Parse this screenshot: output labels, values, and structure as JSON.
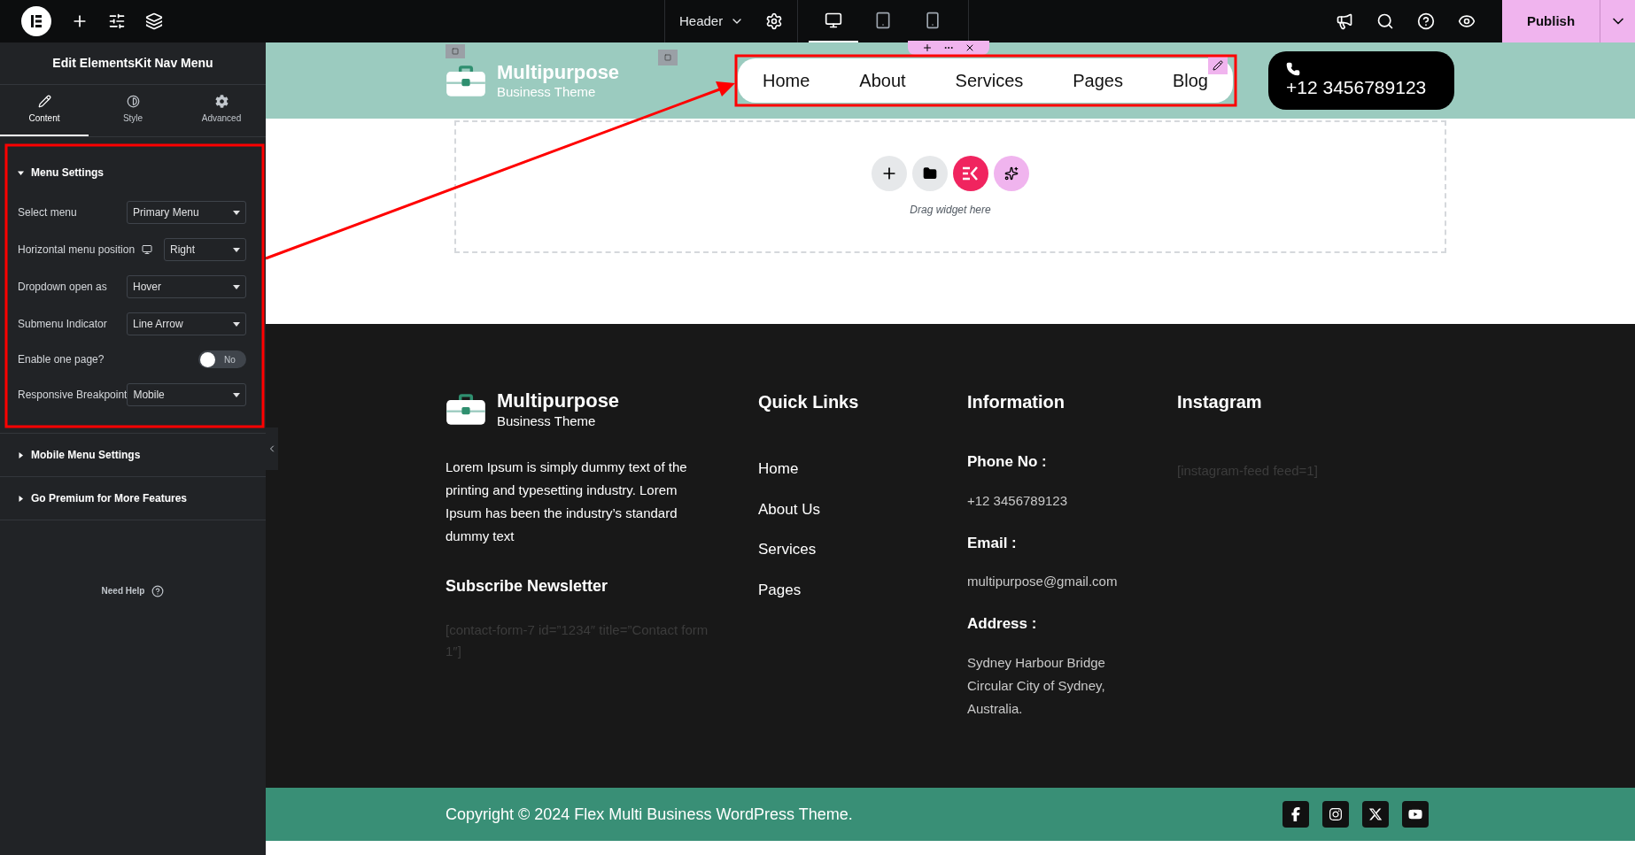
{
  "top_bar": {
    "document": "Header",
    "device_modes": [
      {
        "kind": "desktop",
        "selected": true
      },
      {
        "kind": "tablet",
        "selected": false
      },
      {
        "kind": "mobile",
        "selected": false
      }
    ],
    "publish": "Publish"
  },
  "panel": {
    "title": "Edit ElementsKit Nav Menu",
    "tabs": [
      {
        "kind": "content",
        "label": "Content",
        "selected": true
      },
      {
        "kind": "style",
        "label": "Style",
        "selected": false
      },
      {
        "kind": "advanced",
        "label": "Advanced",
        "selected": false
      }
    ],
    "sections": [
      {
        "title": "Menu Settings",
        "expanded": true,
        "fields": [
          {
            "kind": "select",
            "label": "Select menu",
            "value": "Primary Menu",
            "device_icon": false
          },
          {
            "kind": "select",
            "label": "Horizontal menu position",
            "value": "Right",
            "device_icon": true
          },
          {
            "kind": "select",
            "label": "Dropdown open as",
            "value": "Hover",
            "device_icon": false
          },
          {
            "kind": "select",
            "label": "Submenu Indicator",
            "value": "Line Arrow",
            "device_icon": false
          },
          {
            "kind": "toggle",
            "label": "Enable one page?",
            "value": "No",
            "on": false
          },
          {
            "kind": "select",
            "label": "Responsive Breakpoint",
            "value": "Mobile",
            "device_icon": false
          }
        ]
      },
      {
        "title": "Mobile Menu Settings",
        "expanded": false
      },
      {
        "title": "Go Premium for More Features",
        "expanded": false
      }
    ],
    "help": "Need Help"
  },
  "header": {
    "logo_title": "Multipurpose",
    "logo_subtitle": "Business Theme",
    "nav": [
      "Home",
      "About",
      "Services",
      "Pages",
      "Blog"
    ],
    "phone": "+12 3456789123"
  },
  "drop_zone": {
    "hint": "Drag widget here"
  },
  "footer": {
    "logo_title": "Multipurpose",
    "logo_subtitle": "Business Theme",
    "about": "Lorem Ipsum is simply dummy text of the printing and typesetting industry. Lorem Ipsum has been the industry’s standard dummy text",
    "newsletter_title": "Subscribe Newsletter",
    "newsletter_shortcode": "[contact-form-7 id=”1234″ title=”Contact form 1″]",
    "quick_links": {
      "title": "Quick Links",
      "links": [
        "Home",
        "About Us",
        "Services",
        "Pages"
      ]
    },
    "information": {
      "title": "Information",
      "entries": [
        {
          "label": "Phone No :",
          "value": "+12 3456789123"
        },
        {
          "label": "Email :",
          "value": "multipurpose@gmail.com"
        },
        {
          "label": "Address :",
          "value": "Sydney Harbour Bridge Circular City of Sydney, Australia."
        }
      ]
    },
    "instagram": {
      "title": "Instagram",
      "shortcode": "[instagram-feed feed=1]"
    }
  },
  "copyright": "Copyright © 2024 Flex Multi Business WordPress Theme."
}
